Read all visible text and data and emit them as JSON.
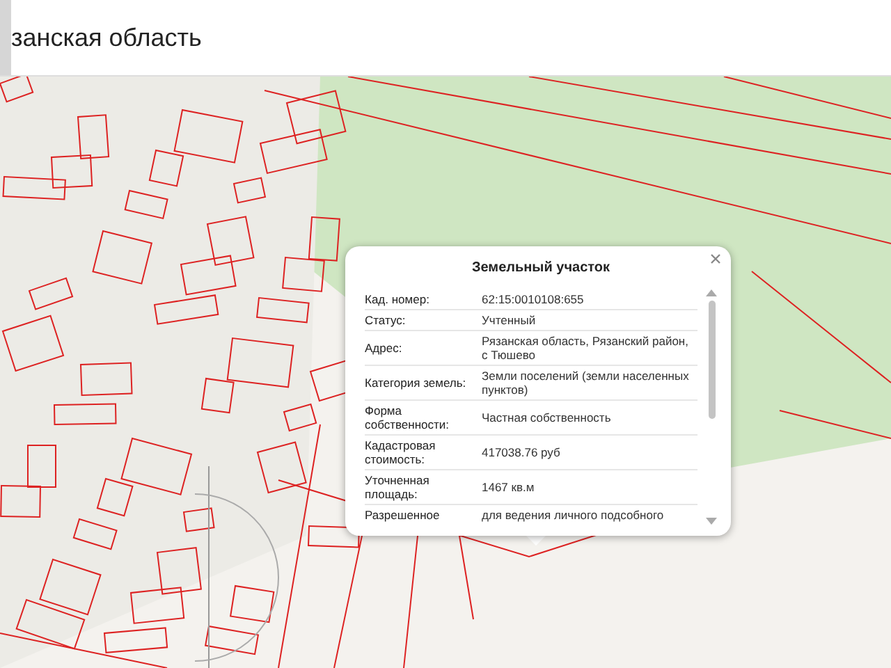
{
  "header": {
    "title": "занская область"
  },
  "popup": {
    "title": "Земельный участок",
    "rows": [
      {
        "label": "Кад. номер:",
        "value": "62:15:0010108:655"
      },
      {
        "label": "Статус:",
        "value": "Учтенный"
      },
      {
        "label": "Адрес:",
        "value": "Рязанская область, Рязанский район, с Тюшево"
      },
      {
        "label": "Категория земель:",
        "value": "Земли поселений (земли населенных пунктов)"
      },
      {
        "label": "Форма собственности:",
        "value": "Частная собственность"
      },
      {
        "label": "Кадастровая стоимость:",
        "value": "417038.76 руб"
      },
      {
        "label": "Уточненная площадь:",
        "value": "1467 кв.м"
      },
      {
        "label": "Разрешенное",
        "value": "для ведения личного подсобного"
      }
    ]
  }
}
